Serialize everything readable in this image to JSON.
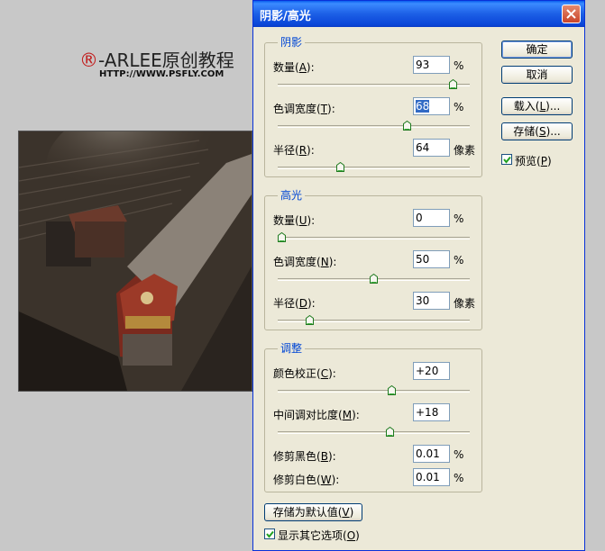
{
  "branding": {
    "mark": "®",
    "name": "-ARLEE原创教程",
    "url": "HTTP://WWW.PSFLY.COM"
  },
  "dialog": {
    "title": "阴影/高光",
    "groups": {
      "shadows": {
        "title": "阴影",
        "amount": {
          "label": "数量",
          "key": "A",
          "value": "93",
          "unit": "%",
          "slider": 0.93
        },
        "tonal": {
          "label": "色调宽度",
          "key": "T",
          "value": "68",
          "unit": "%",
          "slider": 0.68
        },
        "radius": {
          "label": "半径",
          "key": "R",
          "value": "64",
          "unit": "像素",
          "slider": 0.32
        }
      },
      "highlights": {
        "title": "高光",
        "amount": {
          "label": "数量",
          "key": "U",
          "value": "0",
          "unit": "%",
          "slider": 0.0
        },
        "tonal": {
          "label": "色调宽度",
          "key": "N",
          "value": "50",
          "unit": "%",
          "slider": 0.5
        },
        "radius": {
          "label": "半径",
          "key": "D",
          "value": "30",
          "unit": "像素",
          "slider": 0.15
        }
      },
      "adjustments": {
        "title": "调整",
        "color": {
          "label": "颜色校正",
          "key": "C",
          "value": "+20",
          "slider": 0.6
        },
        "midtone": {
          "label": "中间调对比度",
          "key": "M",
          "value": "+18",
          "slider": 0.59
        },
        "black": {
          "label": "修剪黑色",
          "key": "B",
          "value": "0.01",
          "unit": "%"
        },
        "white": {
          "label": "修剪白色",
          "key": "W",
          "value": "0.01",
          "unit": "%"
        }
      }
    },
    "buttons": {
      "ok": "确定",
      "cancel": "取消",
      "load": {
        "label": "载入",
        "key": "L",
        "suffix": "..."
      },
      "save": {
        "label": "存储",
        "key": "S",
        "suffix": "..."
      },
      "save_default": {
        "label": "存储为默认值",
        "key": "V"
      }
    },
    "preview": {
      "label": "预览",
      "key": "P",
      "checked": true
    },
    "more_options": {
      "label": "显示其它选项",
      "key": "O",
      "checked": true
    }
  }
}
